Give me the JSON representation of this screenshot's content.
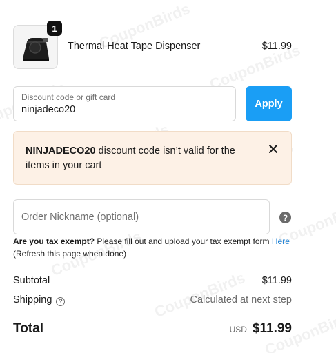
{
  "product": {
    "quantity": "1",
    "name": "Thermal Heat Tape Dispenser",
    "price": "$11.99"
  },
  "discount": {
    "label": "Discount code or gift card",
    "value": "ninjadeco20",
    "apply_label": "Apply"
  },
  "notice": {
    "code": "NINJADECO20",
    "message": " discount code isn’t valid for the items in your cart"
  },
  "nickname": {
    "placeholder": "Order Nickname (optional)"
  },
  "tax": {
    "question": "Are you tax exempt?",
    "text": " Please fill out and upload your tax exempt form ",
    "link": "Here",
    "note": "(Refresh this page when done)"
  },
  "summary": {
    "subtotal_label": "Subtotal",
    "subtotal_value": "$11.99",
    "shipping_label": "Shipping",
    "shipping_value": "Calculated at next step",
    "total_label": "Total",
    "currency": "USD",
    "total_value": "$11.99"
  },
  "watermark": "CouponBirds",
  "colors": {
    "accent": "#1a9ef5",
    "notice_bg": "#fdf1e6",
    "link": "#1a7fd4"
  },
  "icons": {
    "close": "close-icon",
    "help": "question-icon",
    "product": "tape-dispenser-image"
  }
}
